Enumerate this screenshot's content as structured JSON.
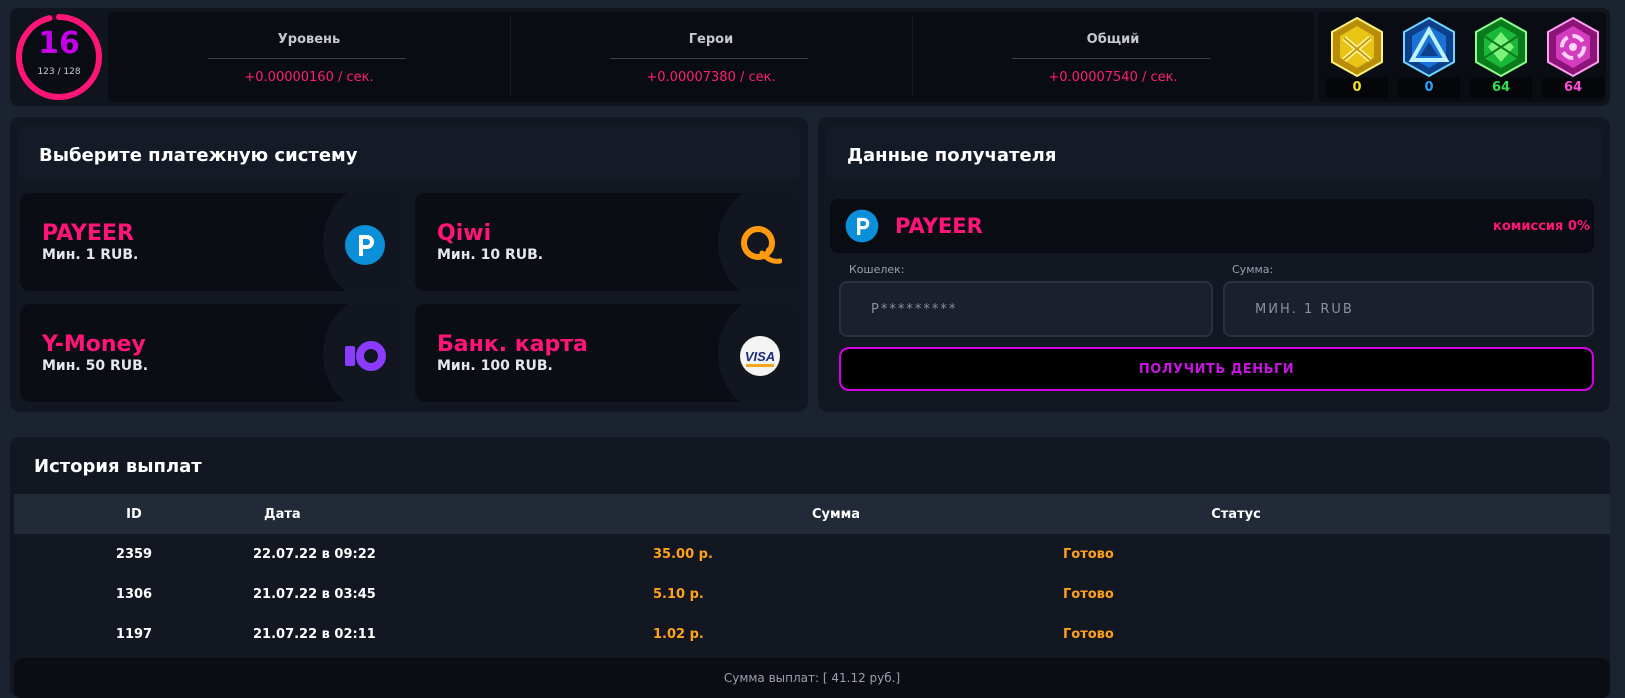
{
  "level": {
    "value": "16",
    "progress_text": "123 / 128",
    "progress": 0.96,
    "ring_color": "#ff1577",
    "number_color": "#c300e8"
  },
  "stats": [
    {
      "title": "Уровень",
      "value": "+0.00000160 / сек."
    },
    {
      "title": "Герои",
      "value": "+0.00007380 / сек."
    },
    {
      "title": "Общий",
      "value": "+0.00007540 / сек."
    }
  ],
  "gems": [
    {
      "name": "yellow-gem-icon",
      "count": "0",
      "color": "#f2e21c"
    },
    {
      "name": "blue-gem-icon",
      "count": "0",
      "color": "#25a4ff"
    },
    {
      "name": "green-gem-icon",
      "count": "64",
      "color": "#36e04c"
    },
    {
      "name": "pink-gem-icon",
      "count": "64",
      "color": "#ff4fd2"
    }
  ],
  "payment": {
    "title": "Выберите платежную систему",
    "methods": [
      {
        "name": "PAYEER",
        "min": "Мин. 1 RUB.",
        "icon": "payeer-icon"
      },
      {
        "name": "Qiwi",
        "min": "Мин. 10 RUB.",
        "icon": "qiwi-icon"
      },
      {
        "name": "Y-Money",
        "min": "Мин. 50 RUB.",
        "icon": "ymoney-icon"
      },
      {
        "name": "Банк. карта",
        "min": "Мин. 100 RUB.",
        "icon": "visa-card-icon"
      }
    ]
  },
  "recipient": {
    "title": "Данные получателя",
    "method": "PAYEER",
    "commission": "комиссия 0%",
    "wallet_label": "Кошелек:",
    "wallet_placeholder": "P*********",
    "amount_label": "Сумма:",
    "amount_placeholder": "МИН. 1 RUB",
    "button": "ПОЛУЧИТЬ ДЕНЬГИ"
  },
  "history": {
    "title": "История выплат",
    "columns": [
      "ID",
      "Дата",
      "Сумма",
      "Статус"
    ],
    "rows": [
      {
        "id": "2359",
        "date": "22.07.22 в 09:22",
        "sum": "35.00 р.",
        "status": "Готово"
      },
      {
        "id": "1306",
        "date": "21.07.22 в 03:45",
        "sum": "5.10 р.",
        "status": "Готово"
      },
      {
        "id": "1197",
        "date": "21.07.22 в 02:11",
        "sum": "1.02 р.",
        "status": "Готово"
      }
    ],
    "total": "Сумма выплат: [ 41.12 руб.]"
  },
  "colors": {
    "accent_pink": "#ff1577",
    "sum_orange": "#ffa21a",
    "button_purple": "#d400e6"
  }
}
